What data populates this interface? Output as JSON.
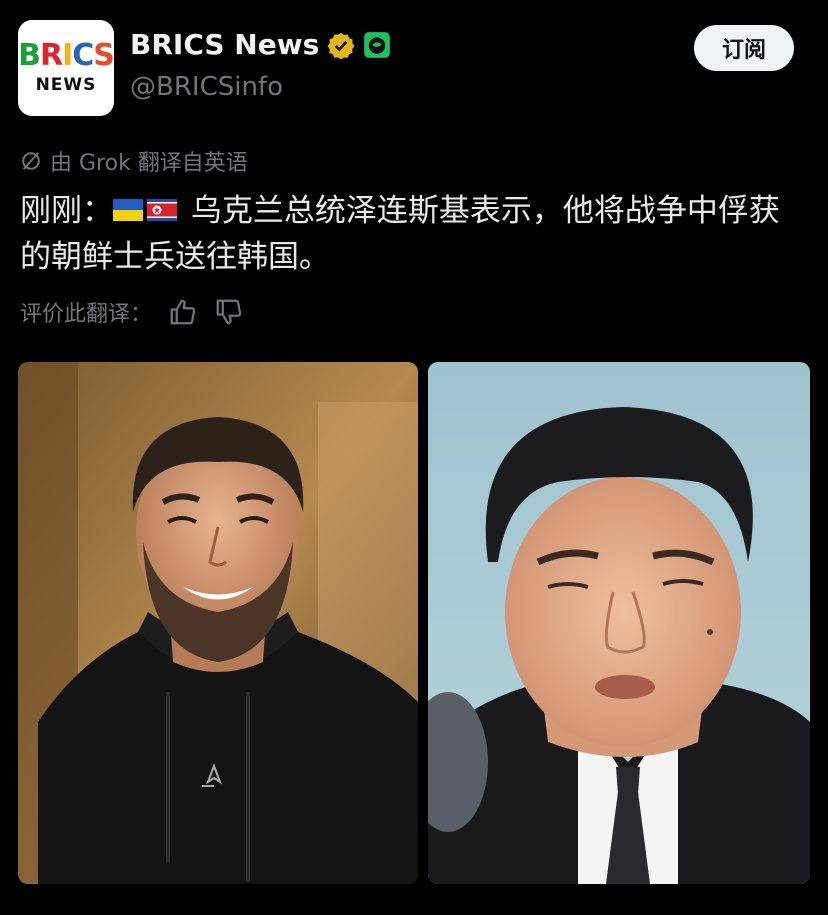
{
  "account": {
    "avatar_top": "BRICS",
    "avatar_bottom": "NEWS",
    "name": "BRICS News",
    "handle": "@BRICSinfo",
    "verified_icon": "verified-gold-badge-icon",
    "affiliate_icon": "green-bird-affiliate-icon"
  },
  "subscribe_label": "订阅",
  "translation": {
    "label": "由 Grok 翻译自英语"
  },
  "tweet": {
    "prefix": "刚刚：",
    "flags": [
      "ukraine-flag-icon",
      "north-korea-flag-icon"
    ],
    "text": " 乌克兰总统泽连斯基表示，他将战争中俘获的朝鲜士兵送往韩国。"
  },
  "rating": {
    "label": "评价此翻译："
  },
  "colors": {
    "background": "#000000",
    "secondary_text": "#71767b",
    "primary_text": "#e7e9ea",
    "verified_gold": "#e2b719",
    "affiliate_green": "#20c05c"
  }
}
